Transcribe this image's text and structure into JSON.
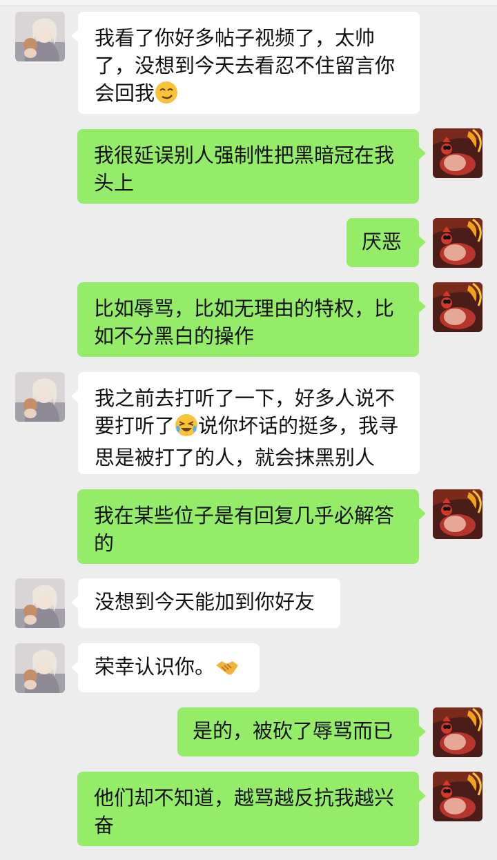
{
  "messages": [
    {
      "side": "left",
      "text_before": "我看了你好多帖子视频了，太帅了，没想到今天去看忍不住留言你会回我",
      "emoji": "smirk-face",
      "text_after": ""
    },
    {
      "side": "right",
      "text_before": "我很延误别人强制性把黑暗冠在我头上",
      "emoji": "",
      "text_after": ""
    },
    {
      "side": "right",
      "text_before": "厌恶",
      "emoji": "",
      "text_after": ""
    },
    {
      "side": "right",
      "text_before": "比如辱骂，比如无理由的特权，比如不分黑白的操作",
      "emoji": "",
      "text_after": ""
    },
    {
      "side": "left",
      "text_before": "我之前去打听了一下，好多人说不要打听了",
      "emoji": "cry-laugh-face",
      "text_after": "说你坏话的挺多，我寻思是被打了的人，就会抹黑别人"
    },
    {
      "side": "right",
      "text_before": "我在某些位子是有回复几乎必解答的",
      "emoji": "",
      "text_after": ""
    },
    {
      "side": "left",
      "text_before": "没想到今天能加到你好友",
      "emoji": "",
      "text_after": ""
    },
    {
      "side": "left",
      "text_before": "荣幸认识你。",
      "emoji": "handshake",
      "text_after": ""
    },
    {
      "side": "right",
      "text_before": "是的，被砍了辱骂而已",
      "emoji": "",
      "text_after": ""
    },
    {
      "side": "right",
      "text_before": "他们却不知道，越骂越反抗我越兴奋",
      "emoji": "",
      "text_after": ""
    }
  ],
  "colors": {
    "background": "#ededed",
    "left_bubble": "#ffffff",
    "right_bubble": "#95ec69"
  }
}
